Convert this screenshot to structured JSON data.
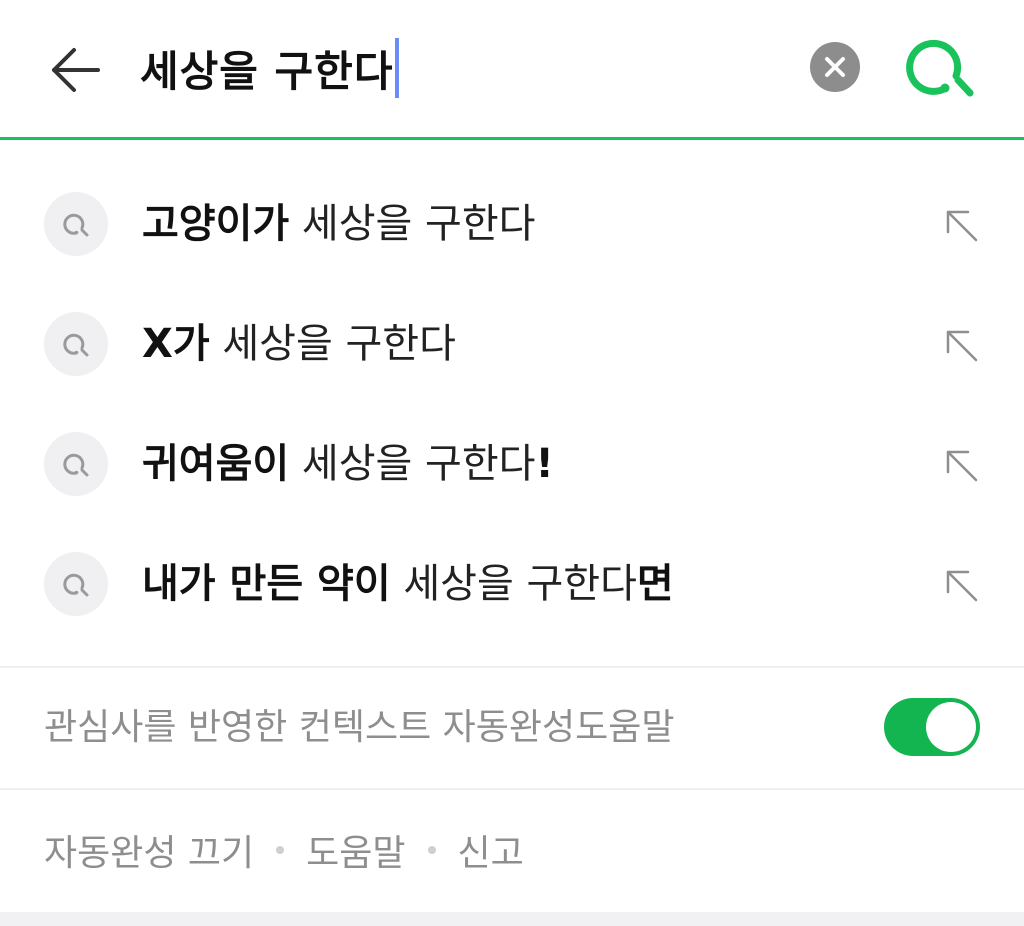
{
  "search": {
    "query": "세상을 구한다",
    "back_icon": "arrow-left-icon",
    "clear_icon": "close-circle-icon",
    "search_icon": "search-icon",
    "accent_color": "#19c25a",
    "caret_color": "#6b8cf5"
  },
  "suggestions": [
    {
      "parts": [
        {
          "text": "고양이가",
          "bold": true
        },
        {
          "text": " 세상을 구한다",
          "bold": false
        }
      ],
      "icon": "search-icon",
      "action_icon": "arrow-up-left-icon"
    },
    {
      "parts": [
        {
          "text": "X가",
          "bold": true
        },
        {
          "text": " 세상을 구한다",
          "bold": false
        }
      ],
      "icon": "search-icon",
      "action_icon": "arrow-up-left-icon"
    },
    {
      "parts": [
        {
          "text": "귀여움이",
          "bold": true
        },
        {
          "text": " 세상을 구한다",
          "bold": false
        },
        {
          "text": "!",
          "bold": true
        }
      ],
      "icon": "search-icon",
      "action_icon": "arrow-up-left-icon"
    },
    {
      "parts": [
        {
          "text": "내가 만든 약이",
          "bold": true
        },
        {
          "text": " 세상을 구한다",
          "bold": false
        },
        {
          "text": "면",
          "bold": true
        }
      ],
      "icon": "search-icon",
      "action_icon": "arrow-up-left-icon"
    }
  ],
  "context_autocomplete": {
    "label": "관심사를 반영한 컨텍스트 자동완성도움말",
    "enabled": true,
    "toggle_color": "#13b551"
  },
  "footer": {
    "links": [
      "자동완성 끄기",
      "도움말",
      "신고"
    ]
  }
}
